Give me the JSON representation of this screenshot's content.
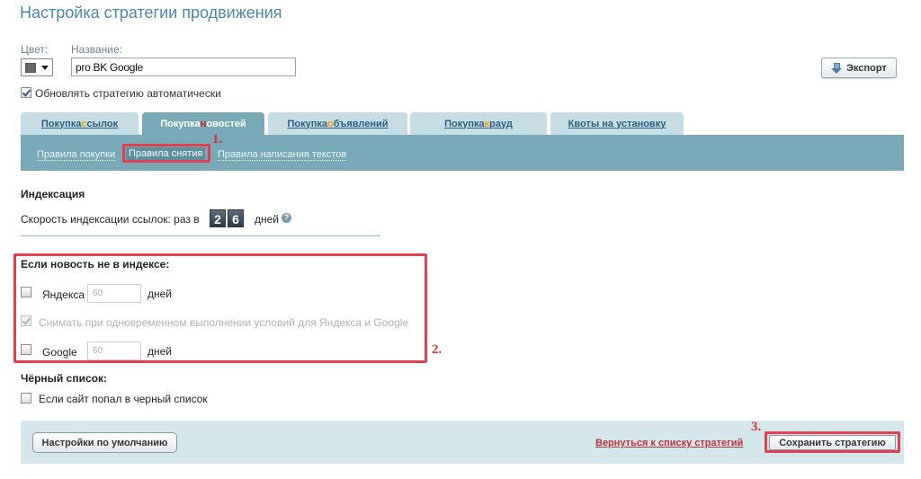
{
  "title": "Настройка стратегии продвижения",
  "form": {
    "color_label": "Цвет:",
    "color_value": "#666666",
    "name_label": "Название:",
    "name_value": "pro BK Google",
    "auto_update_label": "Обновлять стратегию автоматически",
    "auto_update_checked": true,
    "export_label": "Экспорт"
  },
  "tabs": [
    {
      "pre": "Покупка ",
      "hl": "с",
      "post": "сылок",
      "active": false
    },
    {
      "pre": "Покупка ",
      "hl": "н",
      "post": "овостей",
      "active": true
    },
    {
      "pre": "Покупка ",
      "hl": "о",
      "post": "бъявлений",
      "active": false
    },
    {
      "pre": "Покупка ",
      "hl": "к",
      "post": "рауд",
      "active": false
    },
    {
      "pre": "",
      "hl": "",
      "post": "Квоты на установку",
      "active": false
    }
  ],
  "subtabs": [
    {
      "label": "Правила покупки",
      "active": false
    },
    {
      "label": "Правила снятия",
      "active": true
    },
    {
      "label": "Правила написания текстов",
      "active": false
    }
  ],
  "indexing": {
    "heading": "Индексация",
    "speed_prefix": "Скорость индексации ссылок: раз в",
    "digits": [
      "2",
      "6"
    ],
    "speed_suffix": "дней",
    "help_icon": "?"
  },
  "not_indexed": {
    "heading": "Если новость не в индексе:",
    "yandex_label": "Яндекса",
    "yandex_checked": false,
    "yandex_days": "60",
    "days_unit": "дней",
    "both_label": "Снимать при одновременном выполнении условий для Яндекса и Google",
    "both_checked": true,
    "google_label": "Google",
    "google_checked": false,
    "google_days": "60"
  },
  "blacklist": {
    "heading": "Чёрный список:",
    "label": "Если сайт попал в черный список",
    "checked": false
  },
  "footer": {
    "defaults_label": "Настройки по умолчанию",
    "back_link": "Вернуться к списку стратегий",
    "save_label": "Сохранить стратегию"
  },
  "annotations": [
    "1.",
    "2.",
    "3."
  ],
  "colors": {
    "accent": "#79a9b6",
    "tab_inactive": "#c6dde6",
    "annotation_red": "#e04050",
    "title_blue": "#4a88b0"
  }
}
